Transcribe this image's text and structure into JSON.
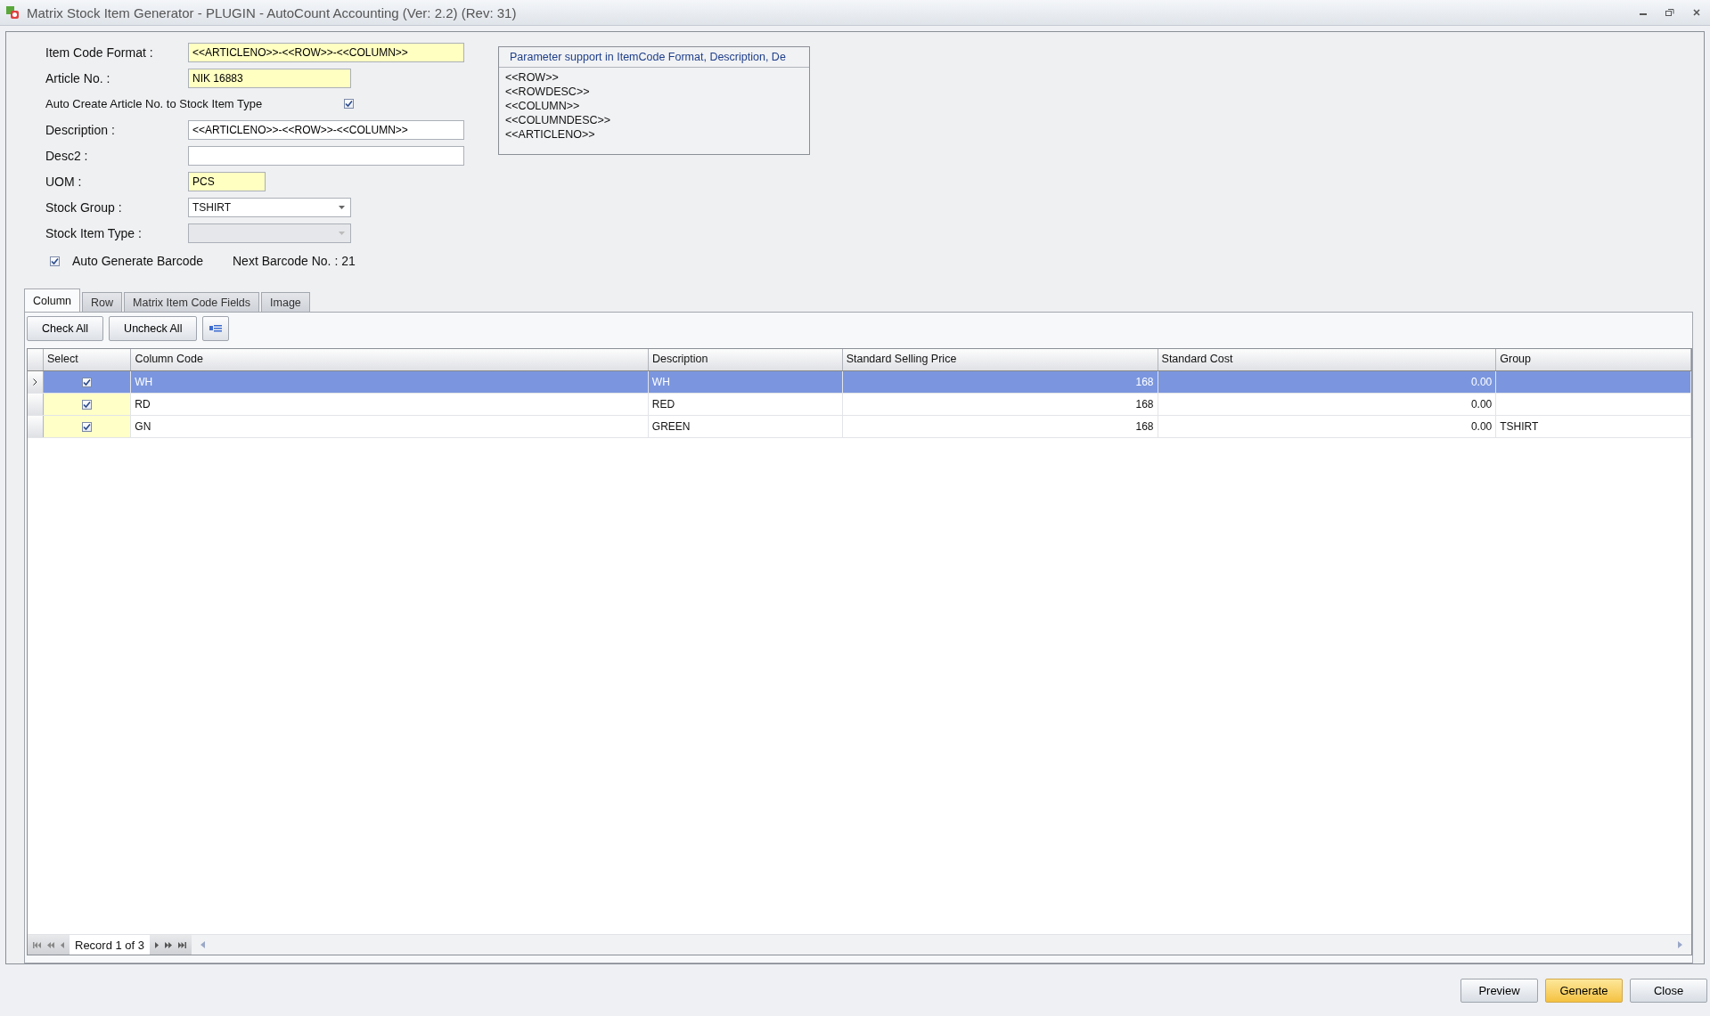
{
  "window": {
    "title": "Matrix Stock Item Generator - PLUGIN - AutoCount Accounting (Ver: 2.2) (Rev: 31)"
  },
  "form": [
    {
      "kind": "field",
      "label": "Item Code Format :",
      "value": "<<ARTICLENO>>-<<ROW>>-<<COLUMN>>",
      "required": true
    },
    {
      "kind": "field",
      "label": "Article No. :",
      "value": "NIK 16883",
      "required": true
    },
    {
      "kind": "checkbox",
      "label": "Auto Create Article No. to Stock Item Type",
      "checked": true
    },
    {
      "kind": "field",
      "label": "Description :",
      "value": "<<ARTICLENO>>-<<ROW>>-<<COLUMN>>",
      "required": false
    },
    {
      "kind": "field",
      "label": "Desc2 :",
      "required": false
    },
    {
      "kind": "field",
      "label": "UOM :",
      "value": "PCS",
      "required": true
    },
    {
      "kind": "dropdown",
      "label": "Stock Group :",
      "value": "TSHIRT",
      "disabled": false
    },
    {
      "kind": "dropdown",
      "label": "Stock Item Type :",
      "disabled": true
    },
    {
      "kind": "barcode",
      "label": "Auto Generate Barcode",
      "checked": true,
      "info": "Next Barcode No. : 21"
    }
  ],
  "parameters": {
    "title": "Parameter support in ItemCode Format, Description, De",
    "items": [
      "<<ROW>>",
      "<<ROWDESC>>",
      "<<COLUMN>>",
      "<<COLUMNDESC>>",
      "<<ARTICLENO>>"
    ]
  },
  "tabs": [
    {
      "label": "Column",
      "selected": true
    },
    {
      "label": "Row",
      "selected": false
    },
    {
      "label": "Matrix Item Code Fields",
      "selected": false
    },
    {
      "label": "Image",
      "selected": false
    }
  ],
  "toolbar": [
    "Check All",
    "Uncheck All"
  ],
  "grid": {
    "select_header": "Select",
    "columns": [
      "Column Code",
      "Description",
      "Standard Selling Price",
      "Standard Cost",
      "Group"
    ],
    "rows": [
      {
        "selected": true,
        "checked": true,
        "cells": [
          "WH",
          "WH",
          "168",
          "0.00",
          ""
        ]
      },
      {
        "selected": false,
        "checked": true,
        "cells": [
          "RD",
          "RED",
          "168",
          "0.00",
          ""
        ]
      },
      {
        "selected": false,
        "checked": true,
        "cells": [
          "GN",
          "GREEN",
          "168",
          "0.00",
          "TSHIRT"
        ]
      }
    ]
  },
  "navigator": {
    "record": "Record 1 of 3"
  },
  "buttons": [
    {
      "label": "Preview",
      "kind": "default"
    },
    {
      "label": "Generate",
      "kind": "primary"
    },
    {
      "label": "Close",
      "kind": "default"
    }
  ]
}
